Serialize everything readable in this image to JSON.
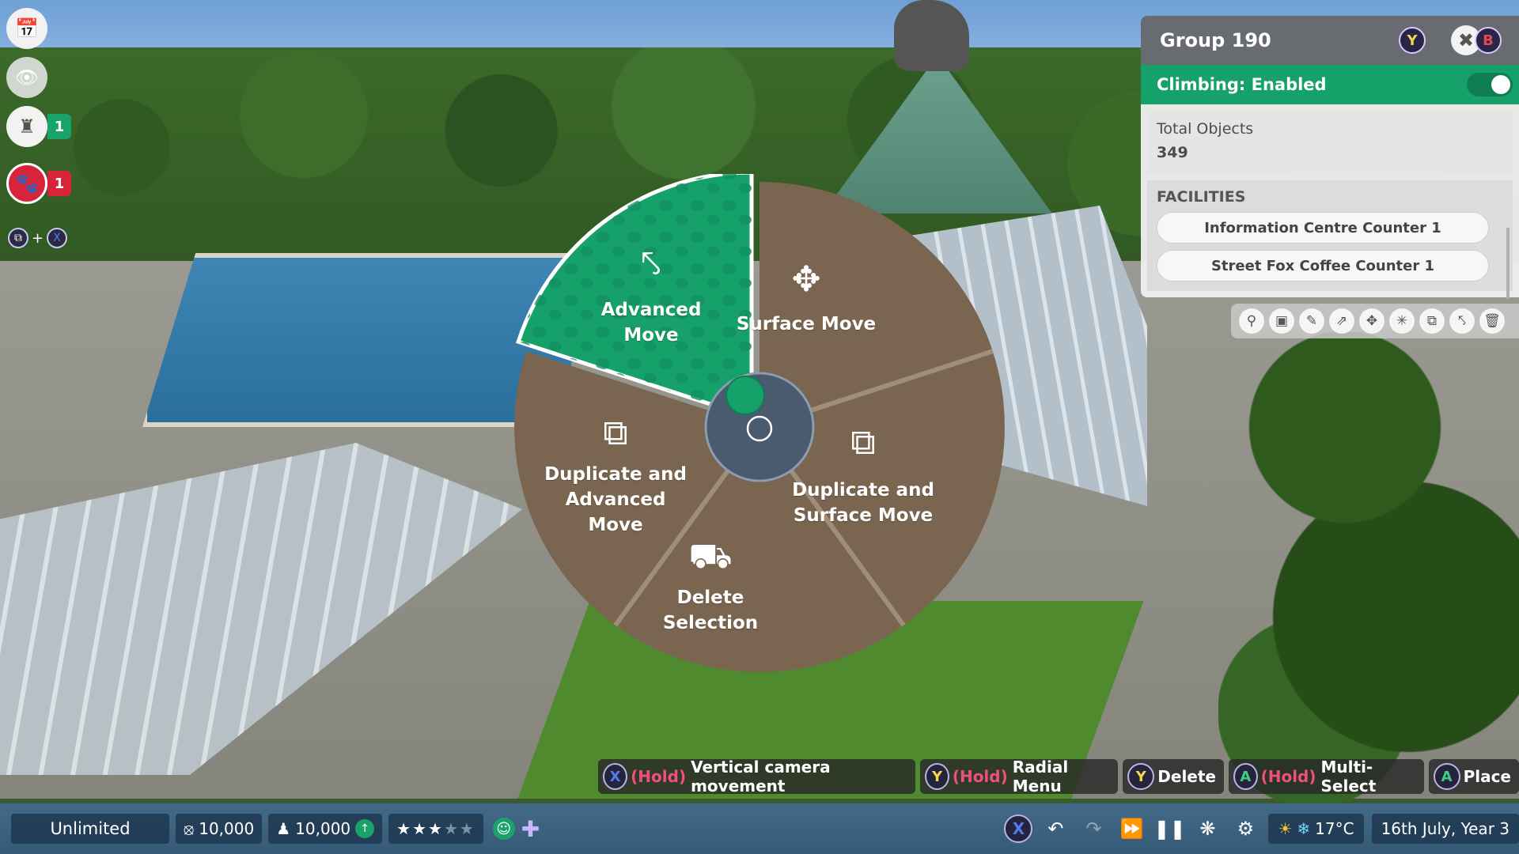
{
  "side_menu": {
    "items": [
      {
        "name": "calendar-icon",
        "glyph": "📅"
      },
      {
        "name": "eye-icon",
        "glyph": "👁"
      },
      {
        "name": "guest-icon",
        "glyph": "♜",
        "badge": "1"
      },
      {
        "name": "paw-icon",
        "glyph": "🐾",
        "badge": "1"
      }
    ],
    "combo_plus": "+",
    "combo_button": "X"
  },
  "radial_menu": {
    "selected": "advanced_move",
    "segments": {
      "advanced_move": {
        "label_line1": "Advanced",
        "label_line2": "Move",
        "icon": "advanced-move-icon"
      },
      "surface_move": {
        "label_line1": "Surface Move",
        "icon": "move-arrows-icon"
      },
      "duplicate_surface_move": {
        "label_line1": "Duplicate and",
        "label_line2": "Surface Move",
        "icon": "duplicate-icon"
      },
      "delete_selection": {
        "label_line1": "Delete",
        "label_line2": "Selection",
        "icon": "bulldozer-icon"
      },
      "duplicate_advanced_move": {
        "label_line1": "Duplicate and",
        "label_line2": "Advanced",
        "label_line3": "Move",
        "icon": "duplicate-advanced-icon"
      }
    },
    "colors": {
      "selected": "#16a06a",
      "segment": "#7a6650",
      "border": "#ffffff"
    }
  },
  "panel": {
    "title": "Group 190",
    "y_button": "Y",
    "b_button": "B",
    "climbing": "Climbing: Enabled",
    "total_label": "Total Objects",
    "total_value": "349",
    "facilities_title": "FACILITIES",
    "facilities": [
      "Information Centre Counter 1",
      "Street Fox Coffee Counter 1"
    ],
    "toolbar_icons": [
      "pin-icon",
      "blueprint-icon",
      "pencil-icon",
      "export-icon",
      "move-icon",
      "advanced-move-icon",
      "duplicate-icon",
      "duplicate-advanced-icon",
      "trash-icon"
    ]
  },
  "hints": [
    {
      "button": "X",
      "hold": "(Hold)",
      "text": "Vertical camera movement"
    },
    {
      "button": "Y",
      "hold": "(Hold)",
      "text": "Radial Menu"
    },
    {
      "button": "Y",
      "hold": "",
      "text": "Delete"
    },
    {
      "button": "A",
      "hold": "(Hold)",
      "text": "Multi-Select"
    },
    {
      "button": "A",
      "hold": "",
      "text": "Place"
    }
  ],
  "statusbar": {
    "mode": "Unlimited",
    "money": "10,000",
    "guests": "10,000",
    "star_rating": 3,
    "star_max": 5,
    "pad_button": "X",
    "temperature": "17°C",
    "date": "16th July, Year 3"
  }
}
